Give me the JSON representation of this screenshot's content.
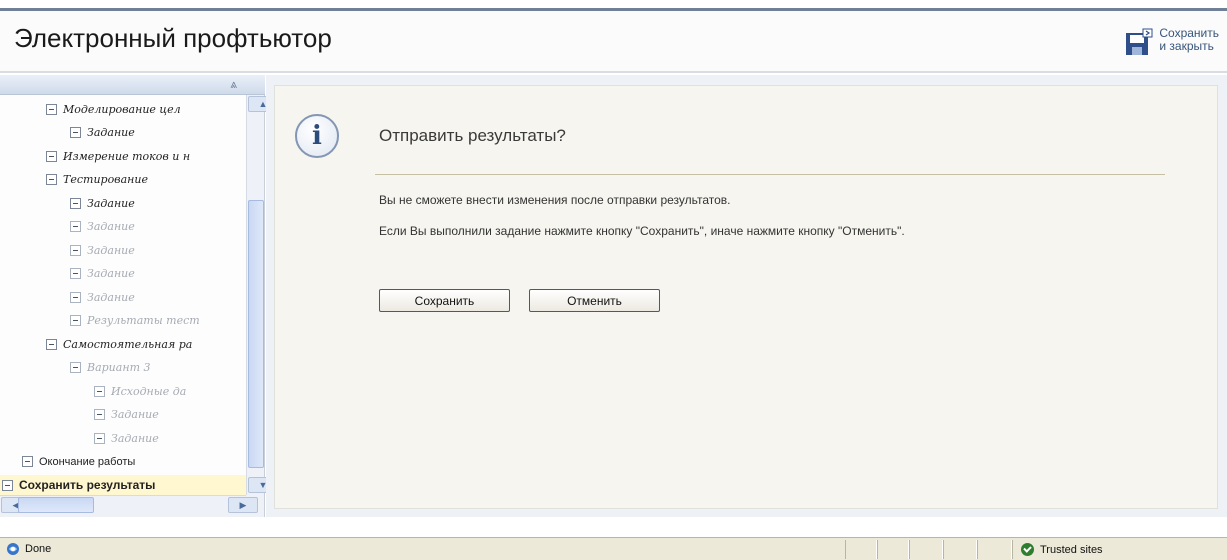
{
  "header": {
    "title": "Электронный профтьютор",
    "save_close_line1": "Сохранить",
    "save_close_line2": "и закрыть",
    "save_close_icon": "floppy-disk-icon"
  },
  "sidebar": {
    "collapse_icon": "double-chevron-up-icon",
    "tree": [
      {
        "label": "Моделирование цел",
        "style": "italic",
        "level": 1
      },
      {
        "label": "Задание",
        "style": "italic",
        "level": 2
      },
      {
        "label": "Измерение токов и н",
        "style": "italic",
        "level": 1
      },
      {
        "label": "Тестирование",
        "style": "italic",
        "level": 1
      },
      {
        "label": "Задание",
        "style": "italic",
        "level": 2
      },
      {
        "label": "Задание",
        "style": "dim",
        "level": 2
      },
      {
        "label": "Задание",
        "style": "dim",
        "level": 2
      },
      {
        "label": "Задание",
        "style": "dim",
        "level": 2
      },
      {
        "label": "Задание",
        "style": "dim",
        "level": 2
      },
      {
        "label": "Результаты тест",
        "style": "dim",
        "level": 2
      },
      {
        "label": "Самостоятельная ра",
        "style": "italic",
        "level": 1
      },
      {
        "label": "Вариант 3",
        "style": "dim",
        "level": 2
      },
      {
        "label": "Исходные да",
        "style": "dim",
        "level": 3
      },
      {
        "label": "Задание",
        "style": "dim",
        "level": 3
      },
      {
        "label": "Задание",
        "style": "dim",
        "level": 3
      },
      {
        "label": "Окончание работы",
        "style": "plain",
        "level": 0
      },
      {
        "label": "Сохранить результаты",
        "style": "bold",
        "level": -1
      }
    ]
  },
  "dialog": {
    "icon": "info-icon",
    "icon_glyph": "i",
    "title": "Отправить результаты?",
    "message1": "Вы не сможете внести изменения после отправки результатов.",
    "message2": "Если Вы выполнили задание нажмите кнопку \"Сохранить\", иначе нажмите кнопку \"Отменить\".",
    "save_label": "Сохранить",
    "cancel_label": "Отменить"
  },
  "statusbar": {
    "status": "Done",
    "zone": "Trusted sites"
  },
  "colors": {
    "dialog_bg": "#f6f5ef",
    "selected_row": "#fff7cf",
    "statusbar_bg": "#ece9d8",
    "trusted_ok": "#2f7d2f"
  }
}
